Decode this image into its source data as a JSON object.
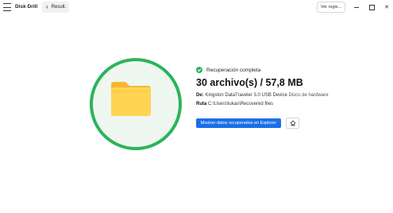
{
  "app": {
    "title": "Disk Drill"
  },
  "toolbar": {
    "back_label": "Result.",
    "log_label": "Ver regis..."
  },
  "status": {
    "text": "Recuperación completa"
  },
  "summary": {
    "headline": "30 archivo(s) / 57,8 MB"
  },
  "details": {
    "from_label": "De:",
    "from_device": "Kingston DataTraveler 3.0 USB Device",
    "from_type": "Disco de hardware",
    "path_label": "Ruta",
    "path_value": "C:\\Users\\lukas\\Recovered files"
  },
  "actions": {
    "show_button": "Mostrar datos recuperados en Explorer"
  },
  "colors": {
    "accent": "#1a6fe8",
    "success": "#2bb45c",
    "folder": "#ffd454"
  }
}
